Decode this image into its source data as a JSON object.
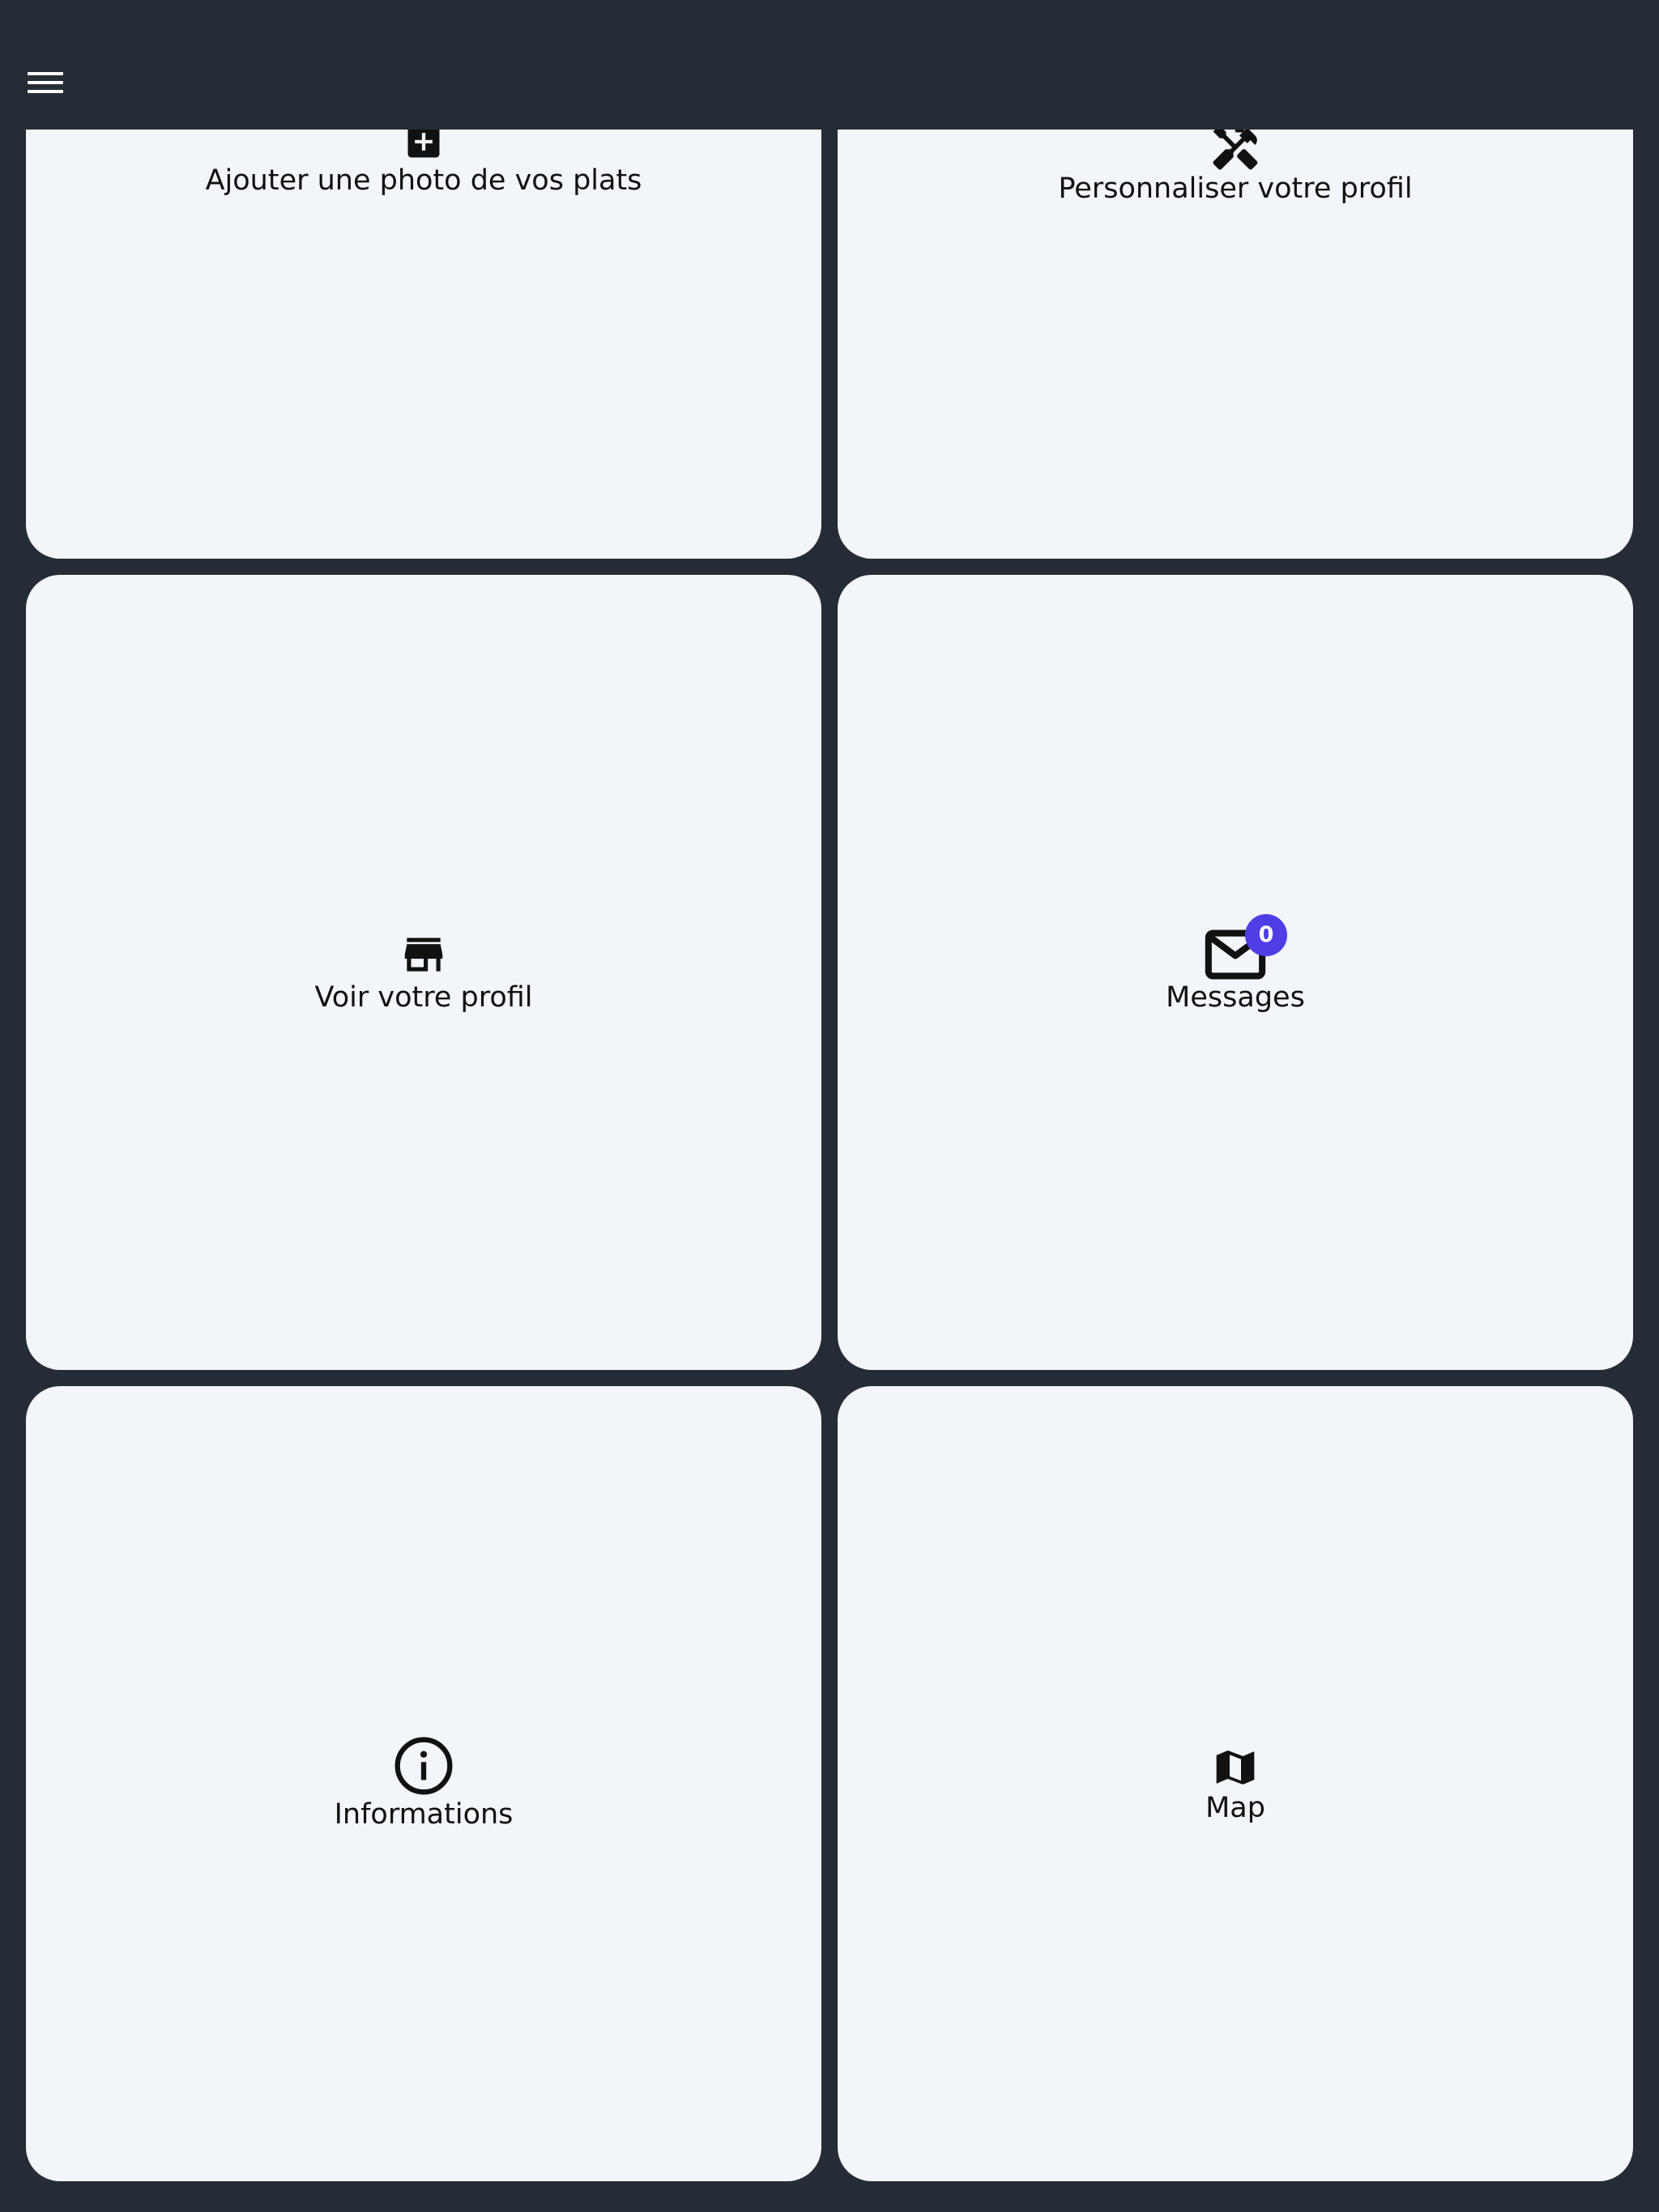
{
  "header": {
    "menu_icon": "hamburger-menu-icon"
  },
  "tiles": {
    "add_photo": {
      "label": "Ajouter une photo de vos plats",
      "icon": "add-box-icon"
    },
    "customize_profile": {
      "label": "Personnaliser votre profil",
      "icon": "tools-icon"
    },
    "view_profile": {
      "label": "Voir votre profil",
      "icon": "storefront-icon"
    },
    "messages": {
      "label": "Messages",
      "icon": "mail-icon",
      "badge_count": "0"
    },
    "informations": {
      "label": "Informations",
      "icon": "info-circle-icon"
    },
    "map": {
      "label": "Map",
      "icon": "map-icon"
    }
  },
  "colors": {
    "background": "#252c35",
    "card": "#f2f5fa",
    "badge": "#4f3ee6",
    "icon": "#111111"
  }
}
